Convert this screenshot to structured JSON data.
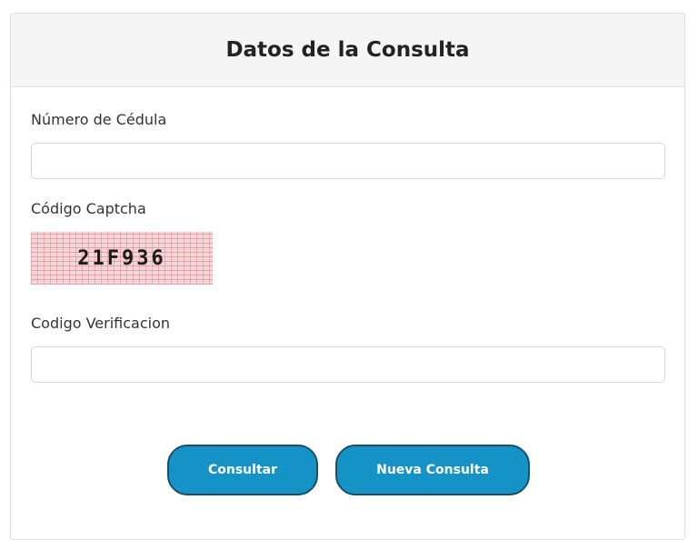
{
  "header": {
    "title": "Datos de la Consulta"
  },
  "form": {
    "cedula": {
      "label": "Número de Cédula",
      "value": "",
      "placeholder": ""
    },
    "captcha": {
      "label": "Código Captcha",
      "code": "21F936"
    },
    "verificacion": {
      "label": "Codigo Verificacion",
      "value": "",
      "placeholder": ""
    }
  },
  "buttons": {
    "consultar_label": "Consultar",
    "nueva_label": "Nueva Consulta"
  },
  "colors": {
    "button_bg": "#1693c6",
    "button_border": "#1b4f66",
    "header_bg": "#f5f5f5",
    "captcha_bg": "#f4d6d8"
  }
}
